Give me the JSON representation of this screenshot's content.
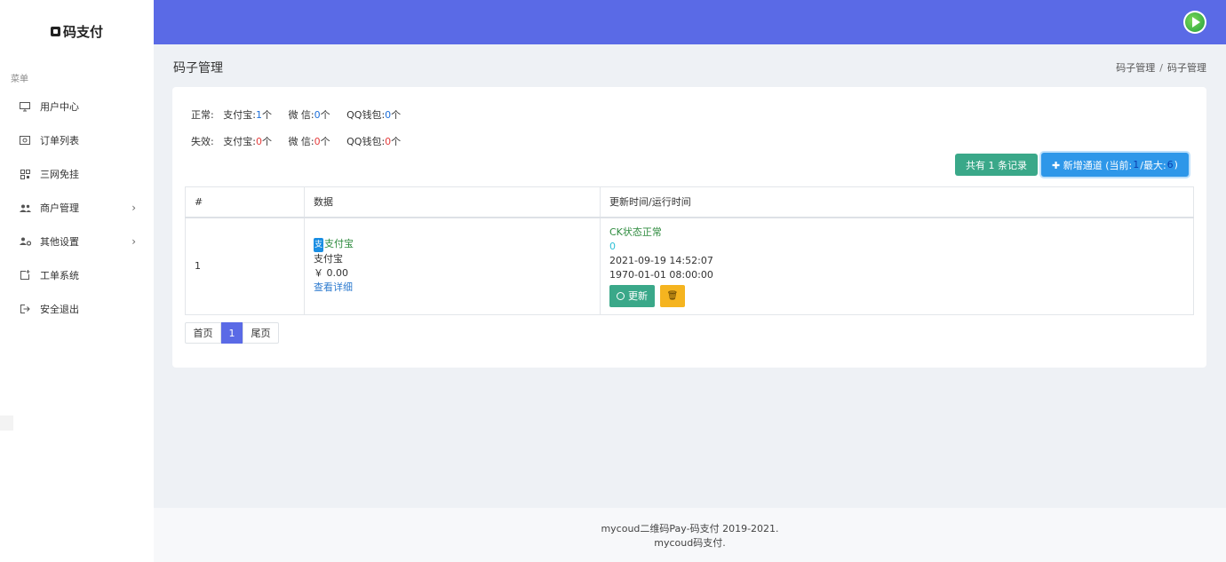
{
  "brand": {
    "name": "码支付"
  },
  "sidebar": {
    "menu_title": "菜单",
    "items": [
      {
        "label": "用户中心",
        "icon": "monitor-icon"
      },
      {
        "label": "订单列表",
        "icon": "dollar-icon"
      },
      {
        "label": "三网免挂",
        "icon": "qrcode-icon"
      },
      {
        "label": "商户管理",
        "icon": "users-icon",
        "has_submenu": true
      },
      {
        "label": "其他设置",
        "icon": "user-gear-icon",
        "has_submenu": true
      },
      {
        "label": "工单系统",
        "icon": "add-square-icon"
      },
      {
        "label": "安全退出",
        "icon": "logout-icon"
      }
    ]
  },
  "header": {
    "avatar": "play-icon"
  },
  "page": {
    "title": "码子管理",
    "breadcrumb": [
      "码子管理",
      "码子管理"
    ],
    "breadcrumb_sep": "/"
  },
  "stats": {
    "normal_label": "正常:",
    "invalid_label": "失效:",
    "normal": {
      "alipay_label": "支付宝:",
      "alipay": "1",
      "wechat_label": "微 信:",
      "wechat": "0",
      "qq_label": "QQ钱包:",
      "qq": "0",
      "unit": "个"
    },
    "invalid": {
      "alipay_label": "支付宝:",
      "alipay": "0",
      "wechat_label": "微 信:",
      "wechat": "0",
      "qq_label": "QQ钱包:",
      "qq": "0",
      "unit": "个"
    }
  },
  "actions": {
    "records": "共有 1 条记录",
    "add_prefix": "✚ 新增通道 (当前: ",
    "add_current": "1",
    "add_mid": "/最大: ",
    "add_max": "6",
    "add_suffix": ")"
  },
  "table": {
    "headers": [
      "#",
      "数据",
      "更新时间/运行时间"
    ],
    "rows": [
      {
        "num": "1",
        "badge": "支",
        "channel": "支付宝",
        "type": "支付宝",
        "amount": "￥ 0.00",
        "detail": "查看详细",
        "status": "CK状态正常",
        "count": "0",
        "updated": "2021-09-19 14:52:07",
        "runtime": "1970-01-01 08:00:00",
        "update_btn": "更新",
        "delete_btn": "🗑"
      }
    ]
  },
  "pager": {
    "first": "首页",
    "current": "1",
    "last": "尾页"
  },
  "footer": {
    "line1": "mycoud二维码Pay-码支付 2019-2021.",
    "line2": "mycoud码支付."
  }
}
